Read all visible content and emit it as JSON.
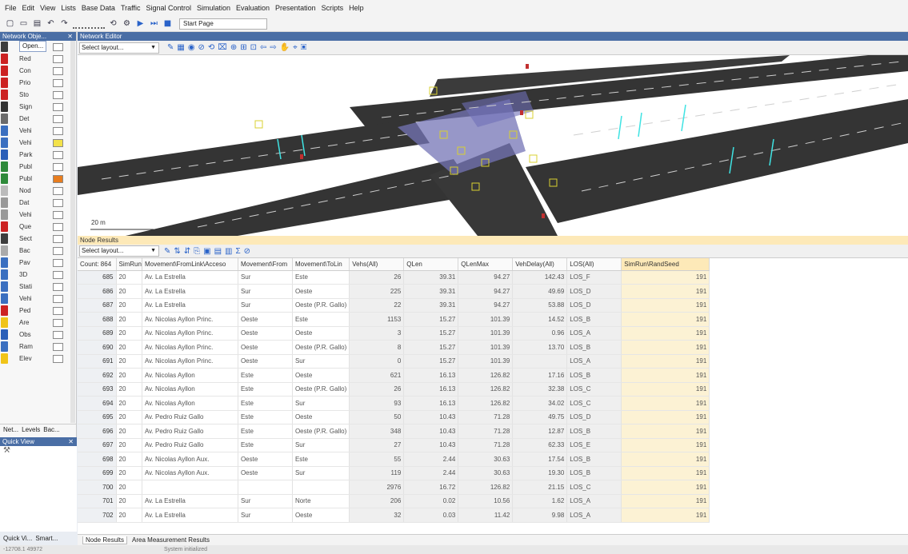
{
  "menu": [
    "File",
    "Edit",
    "View",
    "Lists",
    "Base Data",
    "Traffic",
    "Signal Control",
    "Simulation",
    "Evaluation",
    "Presentation",
    "Scripts",
    "Help"
  ],
  "toolbar": {
    "start_page": "Start Page",
    "icons": [
      "new-icon",
      "open-icon",
      "save-icon",
      "undo-icon",
      "redo-icon",
      "zoom-icon",
      "play-icon",
      "step-icon",
      "stop-icon"
    ]
  },
  "left_panel": {
    "title": "Network Obje...",
    "open_label": "Open...",
    "items": [
      {
        "label": "Desi",
        "icon_color": "#3d3d3d",
        "swatch": "#ffffff"
      },
      {
        "label": "Red",
        "icon_color": "#cc2222",
        "swatch": "#ffffff"
      },
      {
        "label": "Con",
        "icon_color": "#cc2222",
        "swatch": "#ffffff"
      },
      {
        "label": "Prio",
        "icon_color": "#cc2222",
        "swatch": "#ffffff"
      },
      {
        "label": "Sto",
        "icon_color": "#cc2222",
        "swatch": "#ffffff"
      },
      {
        "label": "Sign",
        "icon_color": "#333333",
        "swatch": "#ffffff"
      },
      {
        "label": "Det",
        "icon_color": "#6b6b6b",
        "swatch": "#ffffff"
      },
      {
        "label": "Vehi",
        "icon_color": "#3a6fc0",
        "swatch": "#ffffff"
      },
      {
        "label": "Vehi",
        "icon_color": "#3a6fc0",
        "swatch": "#f3e24a"
      },
      {
        "label": "Park",
        "icon_color": "#2a5fb8",
        "swatch": "#ffffff"
      },
      {
        "label": "Publ",
        "icon_color": "#2e8a3a",
        "swatch": "#ffffff"
      },
      {
        "label": "Publ",
        "icon_color": "#2e8a3a",
        "swatch": "#e87d1e"
      },
      {
        "label": "Nod",
        "icon_color": "#bbbbbb",
        "swatch": "#ffffff"
      },
      {
        "label": "Dat",
        "icon_color": "#999999",
        "swatch": "#ffffff"
      },
      {
        "label": "Vehi",
        "icon_color": "#999999",
        "swatch": "#ffffff"
      },
      {
        "label": "Que",
        "icon_color": "#cc2222",
        "swatch": "#ffffff"
      },
      {
        "label": "Sect",
        "icon_color": "#3d3d3d",
        "swatch": "#ffffff"
      },
      {
        "label": "Bac",
        "icon_color": "#aaaaaa",
        "swatch": "#ffffff"
      },
      {
        "label": "Pav",
        "icon_color": "#3a6fc0",
        "swatch": "#ffffff"
      },
      {
        "label": "3D",
        "icon_color": "#3a6fc0",
        "swatch": "#ffffff"
      },
      {
        "label": "Stati",
        "icon_color": "#3a6fc0",
        "swatch": "#ffffff"
      },
      {
        "label": "Vehi",
        "icon_color": "#3a6fc0",
        "swatch": "#ffffff"
      },
      {
        "label": "Ped",
        "icon_color": "#cc2222",
        "swatch": "#ffffff"
      },
      {
        "label": "Are",
        "icon_color": "#f0c419",
        "swatch": "#ffffff"
      },
      {
        "label": "Obs",
        "icon_color": "#2a5fb8",
        "swatch": "#ffffff"
      },
      {
        "label": "Ram",
        "icon_color": "#3a6fc0",
        "swatch": "#ffffff"
      },
      {
        "label": "Elev",
        "icon_color": "#f0c419",
        "swatch": "#ffffff"
      }
    ],
    "tabs": [
      "Net...",
      "Levels",
      "Bac..."
    ],
    "quick_view_title": "Quick View",
    "bottom_tabs": [
      "Quick Vi...",
      "Smart..."
    ]
  },
  "editor": {
    "title": "Network Editor",
    "layout_placeholder": "Select layout...",
    "scale_label": "20 m"
  },
  "results": {
    "title": "Node Results",
    "layout_placeholder": "Select layout...",
    "columns": [
      "Count: 864",
      "SimRun",
      "Movement\\FromLink\\Acceso",
      "Movement\\From",
      "Movement\\ToLin",
      "Vehs(All)",
      "QLen",
      "QLenMax",
      "VehDelay(All)",
      "LOS(All)",
      "SimRun\\RandSeed"
    ],
    "rows": [
      [
        "685",
        "20",
        "Av. La Estrella",
        "Sur",
        "Este",
        "26",
        "39.31",
        "94.27",
        "142.43",
        "LOS_F",
        "191"
      ],
      [
        "686",
        "20",
        "Av. La Estrella",
        "Sur",
        "Oeste",
        "225",
        "39.31",
        "94.27",
        "49.69",
        "LOS_D",
        "191"
      ],
      [
        "687",
        "20",
        "Av. La Estrella",
        "Sur",
        "Oeste (P.R. Gallo)",
        "22",
        "39.31",
        "94.27",
        "53.88",
        "LOS_D",
        "191"
      ],
      [
        "688",
        "20",
        "Av. Nicolas Ayllon Princ.",
        "Oeste",
        "Este",
        "1153",
        "15.27",
        "101.39",
        "14.52",
        "LOS_B",
        "191"
      ],
      [
        "689",
        "20",
        "Av. Nicolas Ayllon Princ.",
        "Oeste",
        "Oeste",
        "3",
        "15.27",
        "101.39",
        "0.96",
        "LOS_A",
        "191"
      ],
      [
        "690",
        "20",
        "Av. Nicolas Ayllon Princ.",
        "Oeste",
        "Oeste (P.R. Gallo)",
        "8",
        "15.27",
        "101.39",
        "13.70",
        "LOS_B",
        "191"
      ],
      [
        "691",
        "20",
        "Av. Nicolas Ayllon Princ.",
        "Oeste",
        "Sur",
        "0",
        "15.27",
        "101.39",
        "",
        "LOS_A",
        "191"
      ],
      [
        "692",
        "20",
        "Av. Nicolas Ayllon",
        "Este",
        "Oeste",
        "621",
        "16.13",
        "126.82",
        "17.16",
        "LOS_B",
        "191"
      ],
      [
        "693",
        "20",
        "Av. Nicolas Ayllon",
        "Este",
        "Oeste (P.R. Gallo)",
        "26",
        "16.13",
        "126.82",
        "32.38",
        "LOS_C",
        "191"
      ],
      [
        "694",
        "20",
        "Av. Nicolas Ayllon",
        "Este",
        "Sur",
        "93",
        "16.13",
        "126.82",
        "34.02",
        "LOS_C",
        "191"
      ],
      [
        "695",
        "20",
        "Av. Pedro Ruiz Gallo",
        "Este",
        "Oeste",
        "50",
        "10.43",
        "71.28",
        "49.75",
        "LOS_D",
        "191"
      ],
      [
        "696",
        "20",
        "Av. Pedro Ruiz Gallo",
        "Este",
        "Oeste (P.R. Gallo)",
        "348",
        "10.43",
        "71.28",
        "12.87",
        "LOS_B",
        "191"
      ],
      [
        "697",
        "20",
        "Av. Pedro Ruiz Gallo",
        "Este",
        "Sur",
        "27",
        "10.43",
        "71.28",
        "62.33",
        "LOS_E",
        "191"
      ],
      [
        "698",
        "20",
        "Av. Nicolas Ayllon Aux.",
        "Oeste",
        "Este",
        "55",
        "2.44",
        "30.63",
        "17.54",
        "LOS_B",
        "191"
      ],
      [
        "699",
        "20",
        "Av. Nicolas Ayllon Aux.",
        "Oeste",
        "Sur",
        "119",
        "2.44",
        "30.63",
        "19.30",
        "LOS_B",
        "191"
      ],
      [
        "700",
        "20",
        "",
        "",
        "",
        "2976",
        "16.72",
        "126.82",
        "21.15",
        "LOS_C",
        "191"
      ],
      [
        "701",
        "20",
        "Av. La Estrella",
        "Sur",
        "Norte",
        "206",
        "0.02",
        "10.56",
        "1.62",
        "LOS_A",
        "191"
      ],
      [
        "702",
        "20",
        "Av. La Estrella",
        "Sur",
        "Oeste",
        "32",
        "0.03",
        "11.42",
        "9.98",
        "LOS_A",
        "191"
      ]
    ]
  },
  "bottom_tabs": [
    "Node Results",
    "Area Measurement Results"
  ],
  "status": {
    "coords": "-12708.1  49972",
    "message": "System initialized"
  },
  "colors": {
    "panel_title": "#4a6ea5",
    "road": "#3a3a3a",
    "link_blue": "#6f6fb8",
    "seed_col": "#fcf2d4",
    "accent_yellow": "#fde9b8"
  }
}
